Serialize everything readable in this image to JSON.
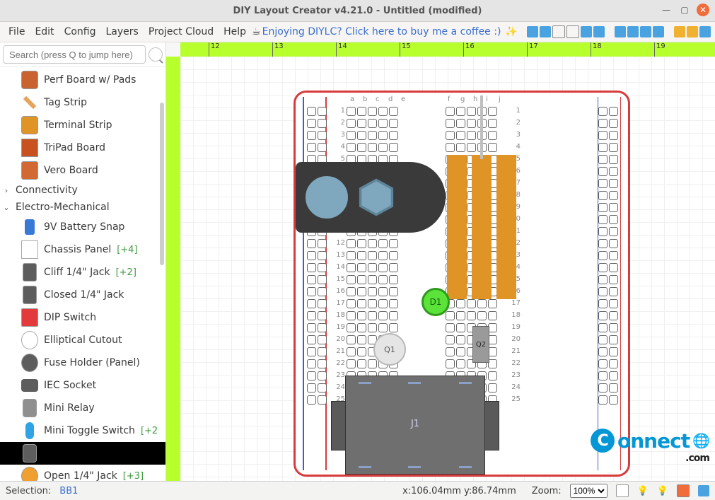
{
  "window": {
    "title": "DIY Layout Creator v4.21.0 - Untitled  (modified)"
  },
  "menu": {
    "items": [
      "File",
      "Edit",
      "Config",
      "Layers",
      "Project Cloud",
      "Help"
    ],
    "coffee": "Enjoying DIYLC? Click here to buy me a coffee :)"
  },
  "search": {
    "placeholder": "Search (press Q to jump here)"
  },
  "tree": {
    "boards": [
      {
        "key": "perf",
        "label": "Perf Board w/ Pads"
      },
      {
        "key": "tag",
        "label": "Tag Strip"
      },
      {
        "key": "term",
        "label": "Terminal Strip"
      },
      {
        "key": "tri",
        "label": "TriPad Board"
      },
      {
        "key": "vero",
        "label": "Vero Board"
      }
    ],
    "cat_connectivity": "Connectivity",
    "cat_electro": "Electro-Mechanical",
    "electro": [
      {
        "key": "batt",
        "label": "9V Battery Snap",
        "tag": ""
      },
      {
        "key": "chassis",
        "label": "Chassis Panel",
        "tag": "[+4]"
      },
      {
        "key": "cliff",
        "label": "Cliff 1/4\" Jack",
        "tag": "[+2]"
      },
      {
        "key": "closed",
        "label": "Closed 1/4\" Jack",
        "tag": ""
      },
      {
        "key": "dip",
        "label": "DIP Switch",
        "tag": ""
      },
      {
        "key": "ellipse",
        "label": "Elliptical Cutout",
        "tag": ""
      },
      {
        "key": "fuse",
        "label": "Fuse Holder (Panel)",
        "tag": ""
      },
      {
        "key": "iec",
        "label": "IEC Socket",
        "tag": ""
      },
      {
        "key": "relay",
        "label": "Mini Relay",
        "tag": ""
      },
      {
        "key": "toggle",
        "label": "Mini Toggle Switch",
        "tag": "[+2"
      },
      {
        "key": "sel",
        "label": "",
        "tag": "",
        "selected": true
      },
      {
        "key": "open",
        "label": "Open 1/4\" Jack",
        "tag": "[+3]"
      }
    ]
  },
  "ruler": {
    "ticks": [
      "12",
      "13",
      "14",
      "15",
      "16",
      "17",
      "18",
      "19"
    ],
    "start": 12
  },
  "components": {
    "d1": "D1",
    "q1": "Q1",
    "q2": "Q2",
    "j1": "J1"
  },
  "board": {
    "cols_left": [
      "a",
      "b",
      "c",
      "d",
      "e"
    ],
    "cols_right": [
      "f",
      "g",
      "h",
      "i",
      "j"
    ],
    "rows": [
      "1",
      "2",
      "3",
      "4",
      "5",
      "6",
      "7",
      "8",
      "9",
      "10",
      "11",
      "12",
      "13",
      "14",
      "15",
      "16",
      "17",
      "18",
      "19",
      "20",
      "21",
      "22",
      "23",
      "24",
      "25"
    ]
  },
  "watermark": {
    "text1": "onnect",
    "text2": ".com"
  },
  "status": {
    "selection_label": "Selection:",
    "selection": "BB1",
    "coords": "x:106.04mm y:86.74mm",
    "zoom_label": "Zoom:",
    "zoom": "100%"
  }
}
